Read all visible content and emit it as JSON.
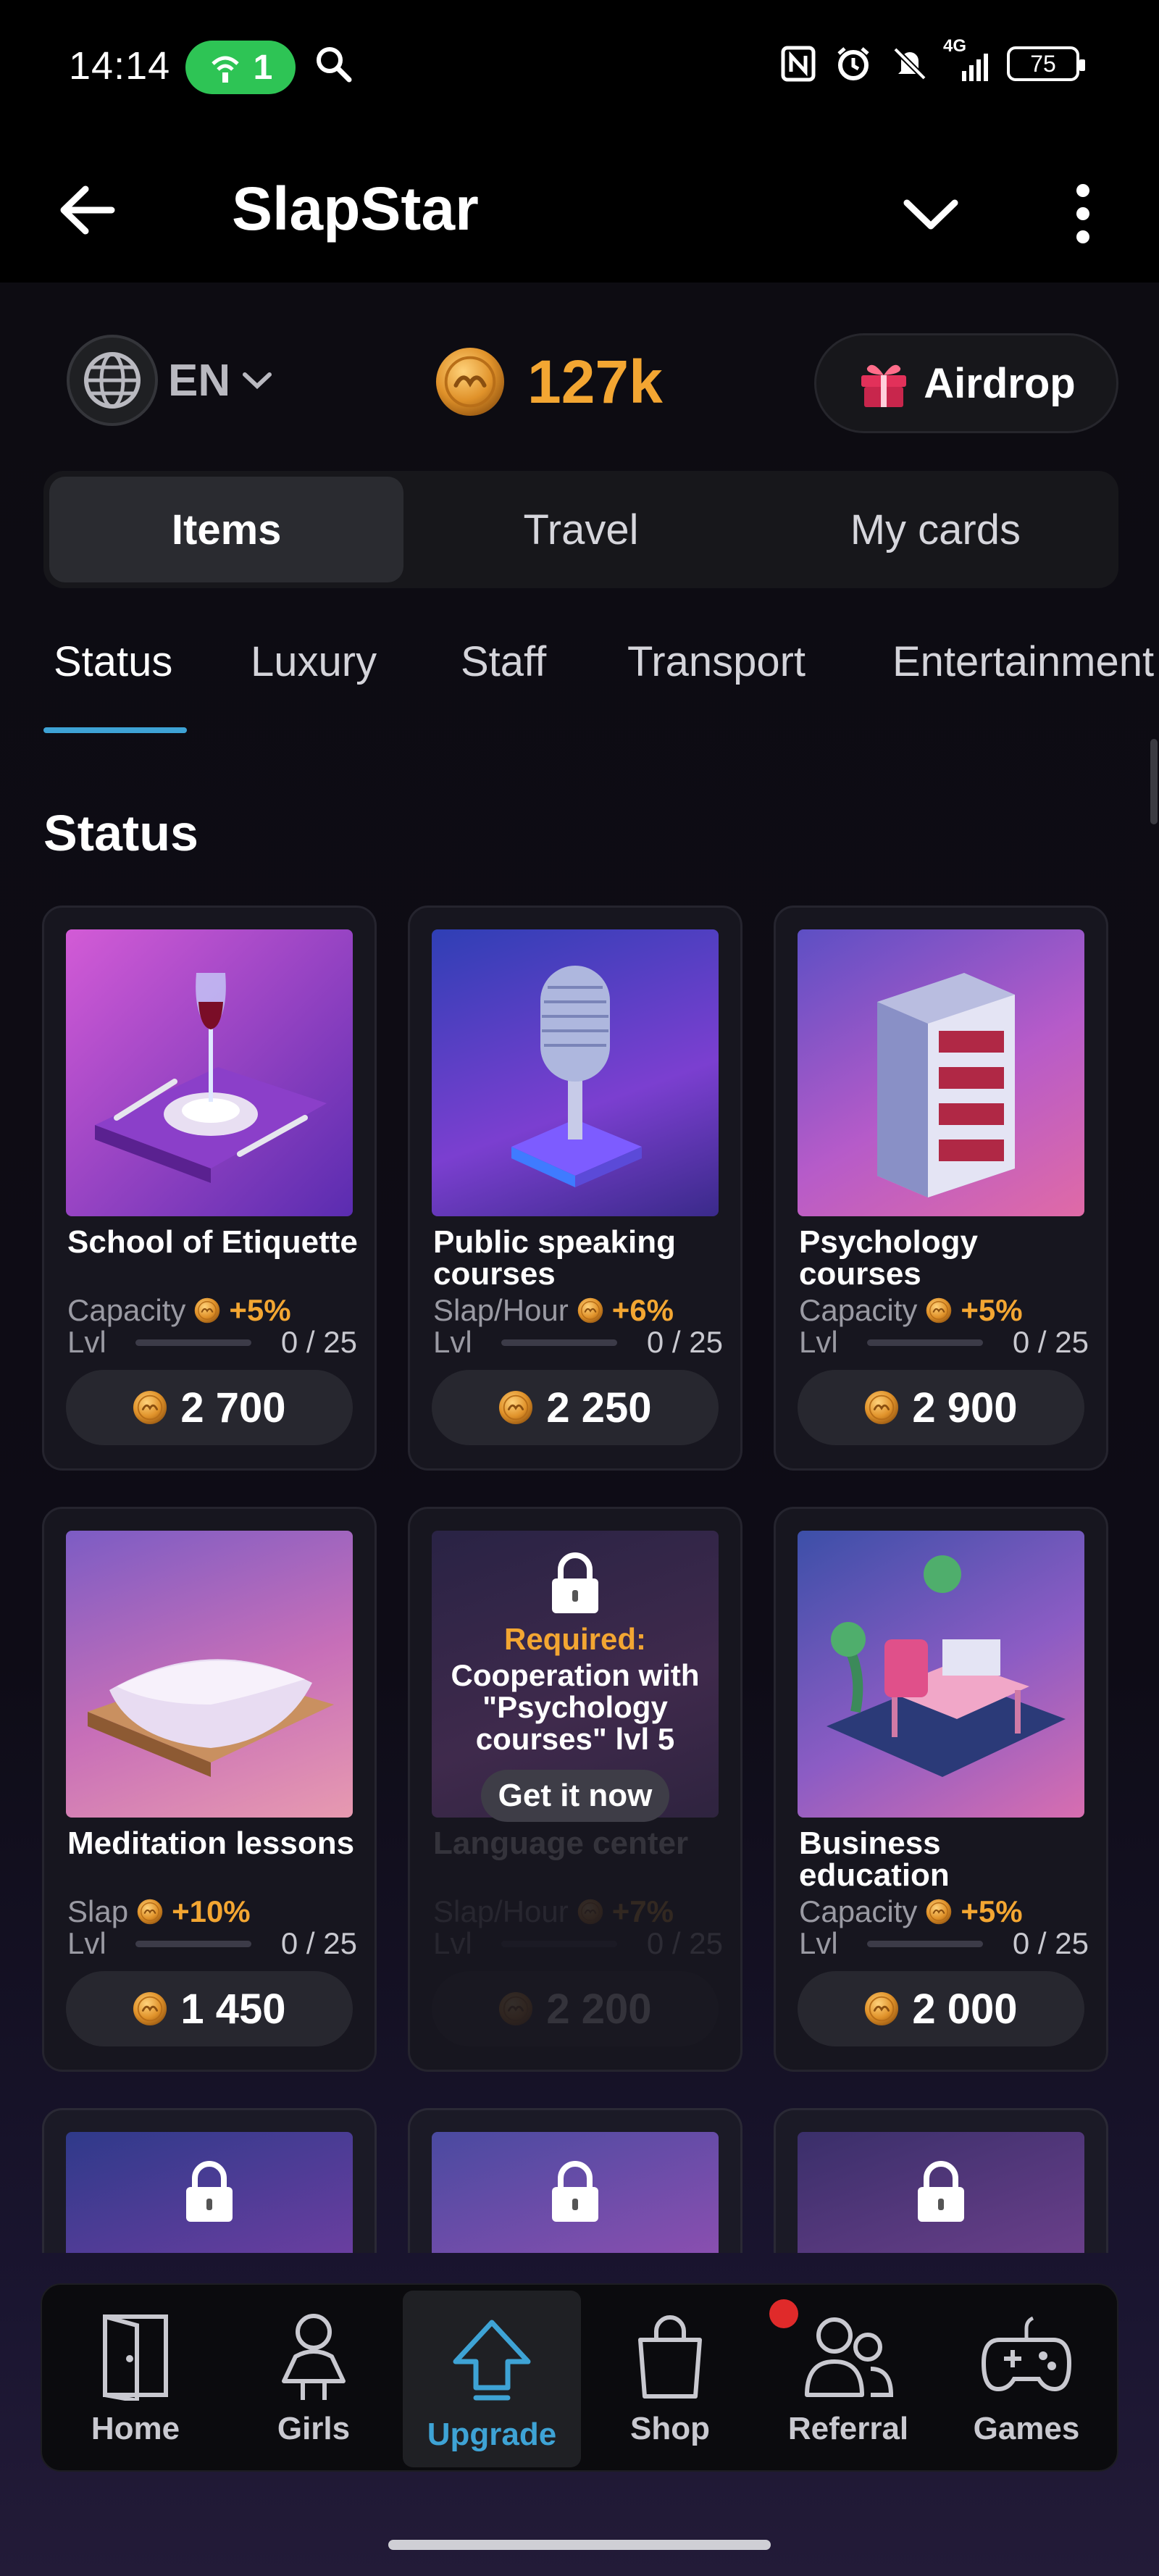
{
  "status_bar": {
    "time": "14:14",
    "hotspot_count": "1",
    "battery": "75",
    "network_label": "4G"
  },
  "header": {
    "title": "SlapStar"
  },
  "top": {
    "language": "EN",
    "balance": "127k",
    "airdrop_label": "Airdrop"
  },
  "segments": [
    {
      "label": "Items",
      "active": true
    },
    {
      "label": "Travel",
      "active": false
    },
    {
      "label": "My cards",
      "active": false
    }
  ],
  "category_tabs": [
    {
      "label": "Status",
      "active": true
    },
    {
      "label": "Luxury",
      "active": false
    },
    {
      "label": "Staff",
      "active": false
    },
    {
      "label": "Transport",
      "active": false
    },
    {
      "label": "Entertainment",
      "active": false
    }
  ],
  "section_title": "Status",
  "cards": [
    {
      "name": "School of Etiquette",
      "stat_label": "Capacity",
      "bonus": "+5%",
      "lvl_label": "Lvl",
      "progress": "0 / 25",
      "price": "2 700",
      "locked": false
    },
    {
      "name": "Public speaking courses",
      "stat_label": "Slap/Hour",
      "bonus": "+6%",
      "lvl_label": "Lvl",
      "progress": "0 / 25",
      "price": "2 250",
      "locked": false
    },
    {
      "name": "Psychology courses",
      "stat_label": "Capacity",
      "bonus": "+5%",
      "lvl_label": "Lvl",
      "progress": "0 / 25",
      "price": "2 900",
      "locked": false
    },
    {
      "name": "Meditation lessons",
      "stat_label": "Slap",
      "bonus": "+10%",
      "lvl_label": "Lvl",
      "progress": "0 / 25",
      "price": "1 450",
      "locked": false
    },
    {
      "name": "Language center",
      "stat_label": "Slap/Hour",
      "bonus": "+7%",
      "lvl_label": "Lvl",
      "progress": "0 / 25",
      "price": "2 200",
      "locked": true,
      "required_label": "Required:",
      "required_text": "Cooperation with \"Psychology courses\" lvl 5",
      "get_label": "Get it now"
    },
    {
      "name": "Business education",
      "stat_label": "Capacity",
      "bonus": "+5%",
      "lvl_label": "Lvl",
      "progress": "0 / 25",
      "price": "2 000",
      "locked": false
    }
  ],
  "bottom_nav": [
    {
      "label": "Home",
      "icon": "door-icon",
      "active": false
    },
    {
      "label": "Girls",
      "icon": "girl-icon",
      "active": false
    },
    {
      "label": "Upgrade",
      "icon": "upgrade-arrow-icon",
      "active": true
    },
    {
      "label": "Shop",
      "icon": "shopping-bag-icon",
      "active": false,
      "badge": true
    },
    {
      "label": "Referral",
      "icon": "people-icon",
      "active": false
    },
    {
      "label": "Games",
      "icon": "gamepad-icon",
      "active": false
    }
  ],
  "colors": {
    "accent": "#3ea3d5",
    "coin": "#f3a632",
    "hotspot": "#2ec455",
    "badge": "#e02a2a"
  }
}
